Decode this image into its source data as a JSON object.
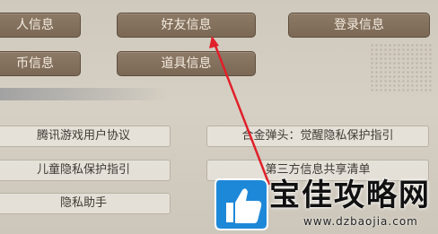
{
  "top_buttons": {
    "personal_info": "人信息",
    "friend_info": "好友信息",
    "login_info": "登录信息",
    "currency_info": "币信息",
    "item_info": "道具信息"
  },
  "links": {
    "tencent_agreement": "腾讯游戏用户协议",
    "game_privacy": "合金弹头：觉醒隐私保护指引",
    "child_privacy": "儿童隐私保护指引",
    "third_party": "第三方信息共享清单",
    "privacy_assistant": "隐私助手"
  },
  "watermark": {
    "title": "宝佳攻略网",
    "url": "www.dzbaojia.com"
  },
  "colors": {
    "button_bg": "#85725f",
    "arrow": "#e0202a",
    "logo_blue": "#1e88d8"
  }
}
